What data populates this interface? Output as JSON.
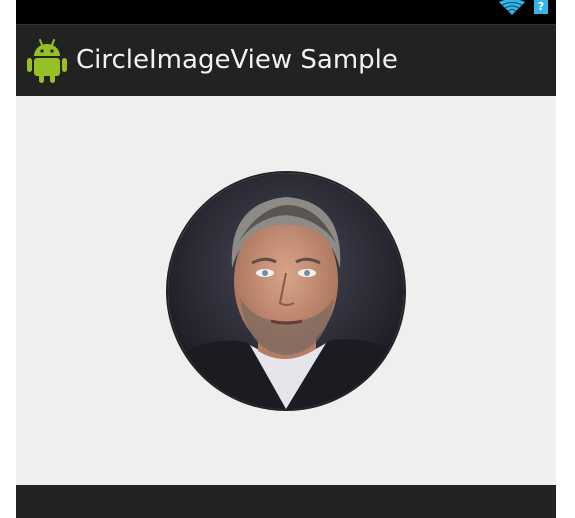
{
  "app": {
    "title": "CircleImageView Sample",
    "icon": "android-robot-icon"
  },
  "status_bar": {
    "icons": [
      "wifi-icon",
      "battery-icon"
    ],
    "battery_glyph": "?"
  },
  "content": {
    "profile_image": "portrait-photo"
  },
  "colors": {
    "action_bar": "#222222",
    "content_bg": "#efefef",
    "status_accent": "#33b5e5",
    "android_green": "#97c024"
  }
}
